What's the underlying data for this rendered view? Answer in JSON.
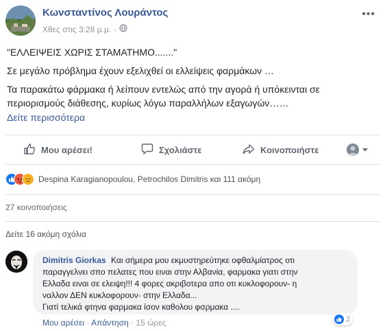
{
  "post": {
    "author": "Κωνσταντίνος Λουράντος",
    "timestamp": "Χθες στις 3:28 μ.μ.",
    "audience_icon": "globe-icon",
    "text_lines": [
      "\"ΕΛΛΕΙΨΕΙΣ ΧΩΡΙΣ ΣΤΑΜΑΤΗΜΟ.......\"",
      "Σε μεγάλο πρόβλημα έχουν εξελιχθεί οι ελλείψεις φαρμάκων …",
      "Τα παρακάτω φάρμακα ή λείπουν εντελώς από την αγορά ή υπόκεινται σε",
      "περιορισμούς διάθεσης, κυρίως λόγω παραλλήλων εξαγωγών……"
    ],
    "see_more": "Δείτε περισσότερα"
  },
  "actions": {
    "like": "Μου αρέσει!",
    "comment": "Σχολιάστε",
    "share": "Κοινοποιήστε"
  },
  "reactions": {
    "icons": [
      "like-reaction-icon",
      "angry-reaction-icon",
      "sad-reaction-icon"
    ],
    "summary": "Despina Karagianopoulou, Petrochilos Dimitris και 111 ακόμη"
  },
  "shares": "27 κοινοποιήσεις",
  "view_more_comments": "Δείτε 16 ακόμη σχόλια",
  "comment": {
    "author": "Dimitris Giorkas",
    "lines": [
      "Και σήμερα μου εκμυστηρεύτηκε οφθαλμίατρος οτι",
      "παραγγελνει σπο πελατες που ειναι στην Αλβανία, φαρμακα γιατι στην",
      "Ελλαδα ειναι σε ελειψη!!! 4 φορες ακριβοτερα απο οτι κυκλοφορουν- η",
      "ναλλον ΔΕΝ κυκλοφορουν- στην Ελλαδα...",
      "Γιατί τελικά φτηνα φαρμακα ίσον καθολου φσρμακα ...."
    ],
    "like_label": "Μου αρέσει",
    "reply_label": "Απάντηση",
    "time": "15 ώρες",
    "reaction_count": "2"
  },
  "colors": {
    "link": "#385898",
    "like_blue": "#1877f2",
    "angry": "#f0593e",
    "sad": "#f7b125"
  }
}
